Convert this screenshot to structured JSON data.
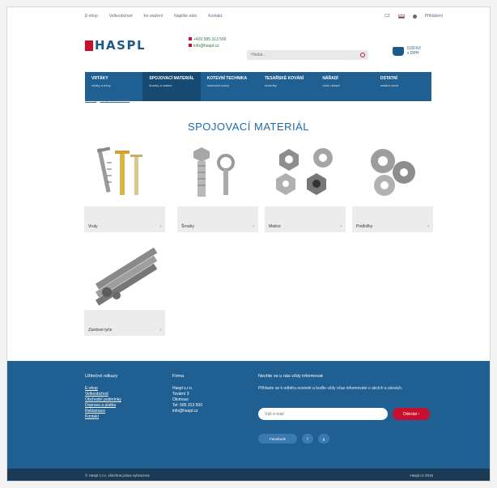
{
  "topbar": {
    "links": [
      "E-shop",
      "Velkoobchod",
      "Ke stažení",
      "Napište nám",
      "Kontakt"
    ],
    "right": {
      "lang": "CZ",
      "login": "Přihlášení"
    }
  },
  "header": {
    "logo": "HASPL",
    "phone": "+420 585 313 500",
    "email": "info@haspl.cz",
    "search_placeholder": "Hledat...",
    "cart": {
      "total": "0,00 Kč",
      "note": "s DPH"
    }
  },
  "nav": [
    {
      "title": "Vrtáky",
      "sub": "vrtáky a frézy"
    },
    {
      "title": "Spojovací materiál",
      "sub": "šrouby a matice"
    },
    {
      "title": "Kotevní technika",
      "sub": "chemické kotvy"
    },
    {
      "title": "Tesařské kování",
      "sub": "úhelníky"
    },
    {
      "title": "Nářadí",
      "sub": "ruční nářadí"
    },
    {
      "title": "Ostatní",
      "sub": "ostatní zboží"
    }
  ],
  "breadcrumb": [
    "E-shop",
    "Spojovací materiál"
  ],
  "page_title": "SPOJOVACÍ MATERIÁL",
  "products": [
    {
      "label": "Vruty",
      "chevron": "›"
    },
    {
      "label": "Šrouby",
      "chevron": "›"
    },
    {
      "label": "Matice",
      "chevron": "›"
    },
    {
      "label": "Podložky",
      "chevron": "›"
    },
    {
      "label": "Závitové tyče",
      "chevron": "›"
    }
  ],
  "footer": {
    "col1_title": "Užitečné odkazy",
    "col1_links": [
      "E-shop",
      "Velkoobchod",
      "Obchodní podmínky",
      "Doprava a platba",
      "Reklamace",
      "Kontakt"
    ],
    "col2_title": "Firma",
    "col2_lines": [
      "Haspl s.r.o.",
      "Tovární 3",
      "Olomouc",
      "Tel: 585 313 500",
      "info@haspl.cz"
    ],
    "newsletter_title": "Nechte se u nás vždy informovat",
    "newsletter_text": "Přihlaste se k odběru novinek a buďte vždy včas informováni o akcích a slevách.",
    "email_placeholder": "Váš e-mail",
    "subscribe": "Odeslat ›",
    "social": [
      "Facebook",
      "f",
      "g"
    ]
  },
  "bottom": {
    "left": "© Haspl s.r.o. všechna práva vyhrazena",
    "right": "Haspl.cz 2016"
  },
  "colors": {
    "brand_blue": "#1f5f92",
    "accent_red": "#c8102e"
  }
}
